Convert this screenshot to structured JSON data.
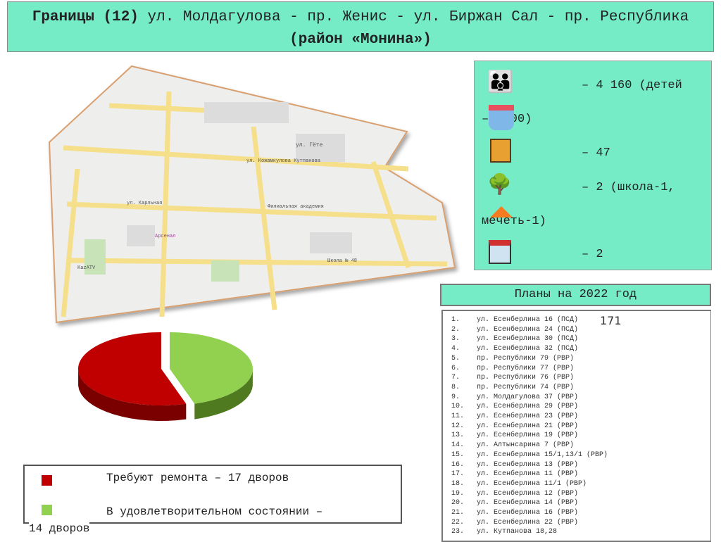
{
  "title": {
    "bold_part": "Границы (12)",
    "normal_part": " ул. Молдагулова - пр. Женис - ул. Биржан Сал - пр. Республика ",
    "bold_part2": "(район «Монина»)"
  },
  "stats": [
    {
      "icon": "family-icon",
      "text": "– 4 160 (детей"
    },
    {
      "icon": "school-building-icon",
      "text": "–1 000)"
    },
    {
      "icon": "apartment-building-icon",
      "text": "– 47"
    },
    {
      "icon": "park-bench-icon",
      "text": "– 2 (школа-1,"
    },
    {
      "icon": "playground-icon",
      "text": "мечеть-1)"
    },
    {
      "icon": "shop-icon",
      "text": "– 2"
    }
  ],
  "plans": {
    "header": "Планы на 2022 год",
    "total": "171",
    "items": [
      "ул. Есенберлина 16 (ПСД)",
      "ул. Есенберлина 24 (ПСД)",
      "ул. Есенберлина 30 (ПСД)",
      "ул. Есенберлина 32 (ПСД)",
      "пр. Республики 79 (РВР)",
      "пр. Республики 77 (РВР)",
      "пр. Республики 76 (РВР)",
      "пр. Республики 74 (РВР)",
      "ул. Молдагулова 37 (РВР)",
      "ул. Есенберлина 29 (РВР)",
      "ул. Есенберлина 23 (РВР)",
      "ул. Есенберлина 21 (РВР)",
      "ул. Есенберлина 19 (РВР)",
      "ул. Алтынсарина 7 (РВР)",
      "ул. Есенберлина 15/1,13/1 (РВР)",
      "ул. Есенберлина 13 (РВР)",
      "ул. Есенберлина 11 (РВР)",
      "ул. Есенберлина 11/1 (РВР)",
      "ул. Есенберлина 12 (РВР)",
      "ул. Есенберлина 14 (РВР)",
      "ул. Есенберлина 16 (РВР)",
      "ул. Есенберлина 22 (РВР)",
      "ул. Кутпанова 18,28"
    ]
  },
  "map": {
    "labels": [
      "ул. Гёте",
      "ул. Кожамкулова Кутпанова",
      "ул. Карльная",
      "Филиальная академия",
      "Школа № 48",
      "Арсенал",
      "KazATV"
    ]
  },
  "chart_data": {
    "type": "pie",
    "categories": [
      "Требуют ремонта",
      "В удовлетворительном состоянии"
    ],
    "values": [
      17,
      14
    ],
    "colors": [
      "#c00000",
      "#92d050"
    ]
  },
  "legend": [
    {
      "color": "#c00000",
      "text": "Требуют ремонта – 17 дворов"
    },
    {
      "color": "#92d050",
      "text": "В удовлетворительном состоянии –",
      "text2": "14 дворов"
    }
  ]
}
